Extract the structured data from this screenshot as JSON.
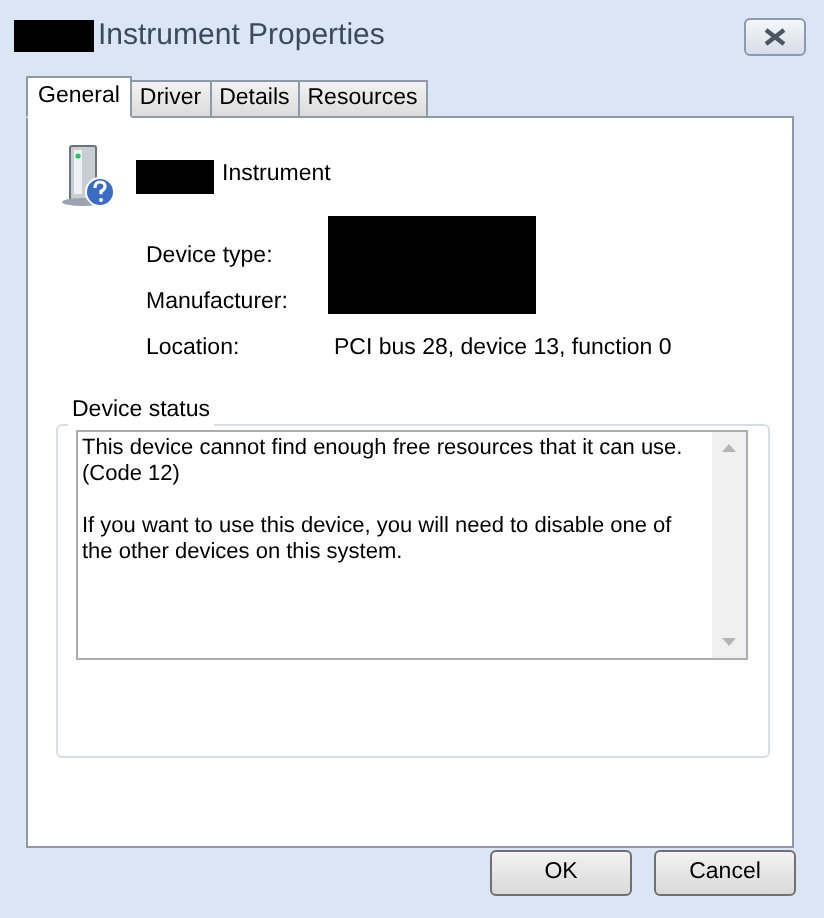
{
  "window": {
    "title": "Instrument Properties"
  },
  "tabs": [
    {
      "label": "General",
      "selected": true
    },
    {
      "label": "Driver",
      "selected": false
    },
    {
      "label": "Details",
      "selected": false
    },
    {
      "label": "Resources",
      "selected": false
    }
  ],
  "device": {
    "name": "Instrument"
  },
  "properties": [
    {
      "label": "Device type:",
      "redacted": true
    },
    {
      "label": "Manufacturer:",
      "redacted": true
    },
    {
      "label": "Location:",
      "redacted": false,
      "value": "PCI bus 28, device 13, function 0"
    }
  ],
  "device_status": {
    "title": "Device status",
    "paragraphs": [
      "This device cannot find enough free resources that it can use. (Code 12)",
      "If you want to use this device, you will need to disable one of the other devices on this system."
    ]
  },
  "buttons": [
    "OK",
    "Cancel"
  ]
}
